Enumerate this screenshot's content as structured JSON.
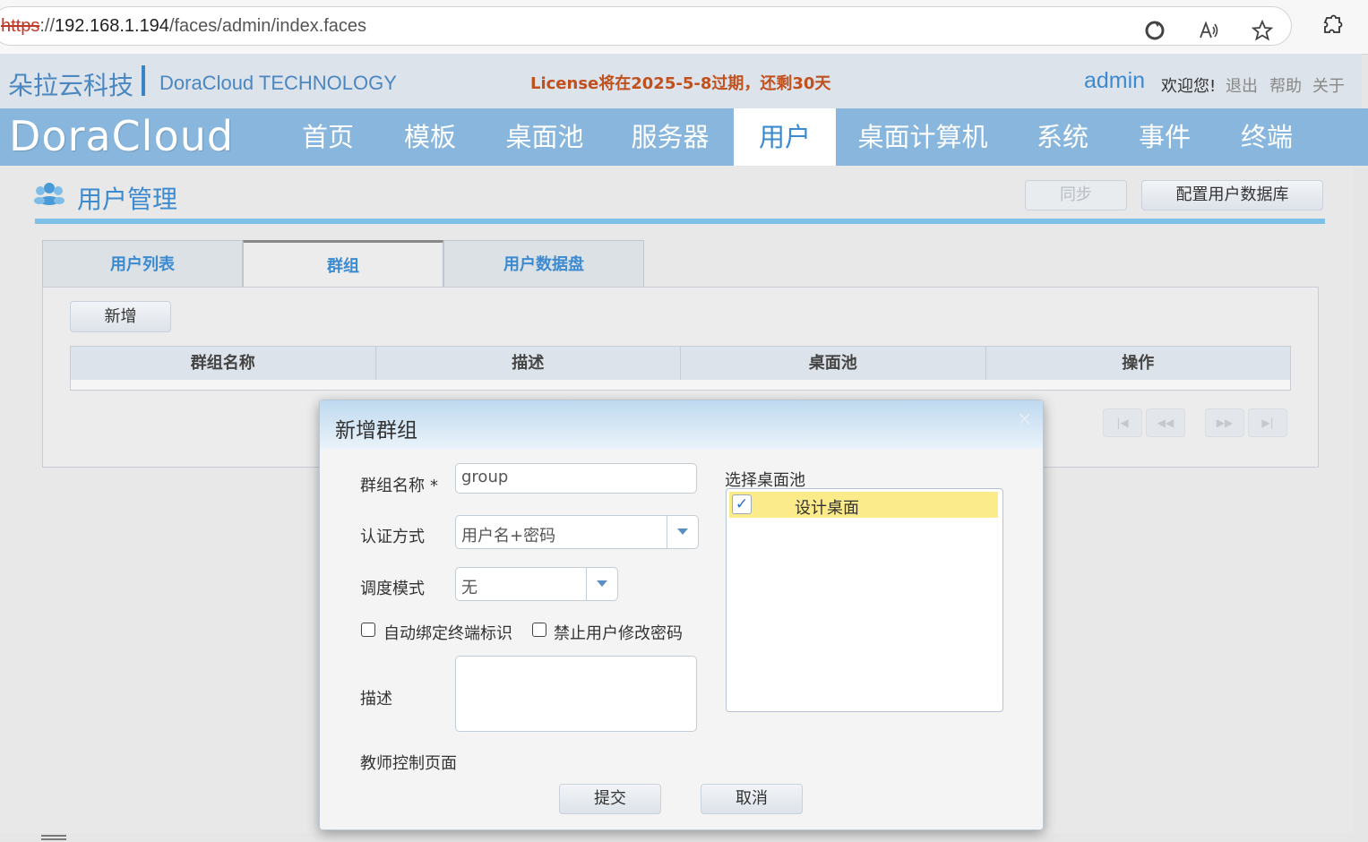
{
  "browser": {
    "url_scheme": "https",
    "url_sep": "://",
    "url_host": "192.168.1.194",
    "url_path": "/faces/admin/index.faces",
    "icons": [
      "refresh-icon",
      "read-aloud-icon",
      "favorite-star-icon",
      "extensions-icon"
    ]
  },
  "header": {
    "brand_cn": "朵拉云科技",
    "brand_en": "DoraCloud TECHNOLOGY",
    "license_notice": "License将在2025-5-8过期，还剩30天",
    "user": "admin",
    "welcome": "欢迎您!",
    "links": [
      "退出",
      "帮助",
      "关于"
    ]
  },
  "nav": {
    "logo": "DoraCloud",
    "items": [
      "首页",
      "模板",
      "桌面池",
      "服务器",
      "用户",
      "桌面计算机",
      "系统",
      "事件",
      "终端"
    ],
    "active_index": 4
  },
  "page": {
    "title": "用户管理",
    "sync_button": "同步",
    "config_button": "配置用户数据库",
    "tabs": [
      "用户列表",
      "群组",
      "用户数据盘"
    ],
    "active_tab": 1,
    "add_button": "新增",
    "table_headers": [
      "群组名称",
      "描述",
      "桌面池",
      "操作"
    ],
    "pager_icons": [
      "first-page-icon",
      "prev-page-icon",
      "next-page-icon",
      "last-page-icon"
    ]
  },
  "dialog": {
    "title": "新增群组",
    "close_glyph": "×",
    "name_label": "群组名称",
    "required_mark": "*",
    "name_value": "group",
    "auth_label": "认证方式",
    "auth_value": "用户名+密码",
    "schedule_label": "调度模式",
    "schedule_value": "无",
    "auto_bind_label": "自动绑定终端标识",
    "auto_bind_checked": false,
    "forbid_pwd_label": "禁止用户修改密码",
    "forbid_pwd_checked": false,
    "desc_label": "描述",
    "desc_value": "",
    "teacher_label": "教师控制页面",
    "pool_label": "选择桌面池",
    "pools": [
      {
        "label": "设计桌面",
        "checked": true
      }
    ],
    "submit": "提交",
    "cancel": "取消"
  },
  "colors": {
    "nav_bg": "#88b6dc",
    "accent": "#3c8ad0",
    "license": "#c0501e",
    "selected_row": "#fbeb8a"
  }
}
